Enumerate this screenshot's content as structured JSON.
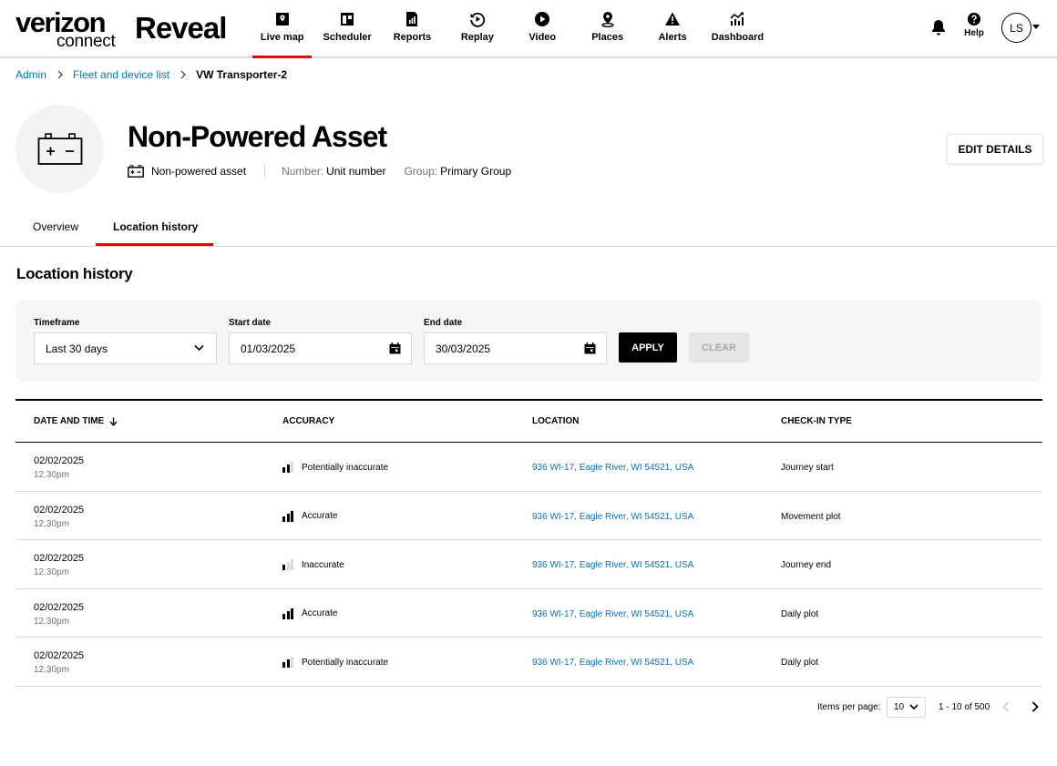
{
  "brand": {
    "top": "verizon",
    "bottom": "connect",
    "product": "Reveal"
  },
  "nav": [
    {
      "label": "Live map",
      "icon": "map-icon",
      "active": true
    },
    {
      "label": "Scheduler",
      "icon": "calendar-icon",
      "active": false
    },
    {
      "label": "Reports",
      "icon": "report-icon",
      "active": false
    },
    {
      "label": "Replay",
      "icon": "replay-icon",
      "active": false
    },
    {
      "label": "Video",
      "icon": "play-icon",
      "active": false
    },
    {
      "label": "Places",
      "icon": "place-pin-icon",
      "active": false
    },
    {
      "label": "Alerts",
      "icon": "alert-icon",
      "active": false
    },
    {
      "label": "Dashboard",
      "icon": "dashboard-icon",
      "active": false
    }
  ],
  "header_right": {
    "help_label": "Help",
    "avatar_initials": "LS"
  },
  "breadcrumb": {
    "admin": "Admin",
    "fleet": "Fleet and device list",
    "current": "VW Transporter-2"
  },
  "asset": {
    "title": "Non-Powered Asset",
    "type": "Non-powered asset",
    "number_label": "Number:",
    "number_value": "Unit number",
    "group_label": "Group:",
    "group_value": "Primary Group",
    "edit_label": "EDIT DETAILS"
  },
  "tabs": {
    "overview": "Overview",
    "history": "Location history"
  },
  "section_title": "Location history",
  "filters": {
    "timeframe_label": "Timeframe",
    "timeframe_value": "Last 30 days",
    "start_label": "Start date",
    "start_value": "01/03/2025",
    "end_label": "End date",
    "end_value": "30/03/2025",
    "apply_label": "APPLY",
    "clear_label": "CLEAR"
  },
  "table": {
    "headers": {
      "date": "DATE AND TIME",
      "accuracy": "ACCURACY",
      "location": "LOCATION",
      "type": "CHECK-IN TYPE"
    },
    "rows": [
      {
        "date": "02/02/2025",
        "time": "12.30pm",
        "accuracy": "Potentially inaccurate",
        "accuracy_level": 2,
        "location": "936 WI-17, Eagle River, WI 54521, USA",
        "type": "Journey start"
      },
      {
        "date": "02/02/2025",
        "time": "12.30pm",
        "accuracy": "Accurate",
        "accuracy_level": 3,
        "location": "936 WI-17, Eagle River, WI 54521, USA",
        "type": "Movement plot"
      },
      {
        "date": "02/02/2025",
        "time": "12.30pm",
        "accuracy": "Inaccurate",
        "accuracy_level": 1,
        "location": "936 WI-17, Eagle River, WI 54521, USA",
        "type": "Journey end"
      },
      {
        "date": "02/02/2025",
        "time": "12.30pm",
        "accuracy": "Accurate",
        "accuracy_level": 3,
        "location": "936 WI-17, Eagle River, WI 54521, USA",
        "type": "Daily plot"
      },
      {
        "date": "02/02/2025",
        "time": "12.30pm",
        "accuracy": "Potentially inaccurate",
        "accuracy_level": 2,
        "location": "936 WI-17, Eagle River, WI 54521, USA",
        "type": "Daily plot"
      }
    ]
  },
  "pagination": {
    "items_label": "Items per page:",
    "items_value": "10",
    "range": "1 - 10 of 500"
  },
  "colors": {
    "accent": "#ee0000",
    "link": "#0a6fb5",
    "muted": "#6f7171"
  }
}
